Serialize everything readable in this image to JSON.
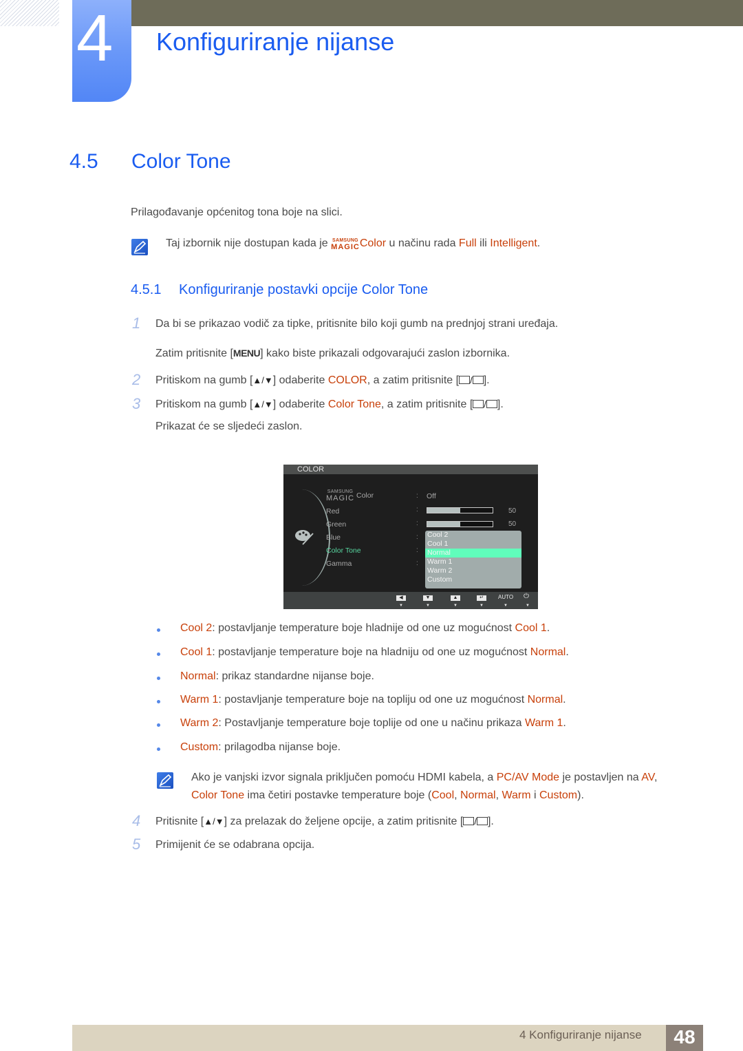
{
  "chapter": {
    "number": "4",
    "title": "Konfiguriranje nijanse"
  },
  "section": {
    "number": "4.5",
    "title": "Color Tone"
  },
  "intro": "Prilagođavanje općenitog tona boje na slici.",
  "note1": {
    "icon": "note-pencil-icon",
    "before": "Taj izbornik nije dostupan kada je ",
    "magic_small": "SAMSUNG",
    "magic_big": "MAGIC",
    "magic_word": "Color",
    "mid": " u načinu rada ",
    "opt1": "Full",
    "or": " ili ",
    "opt2": "Intelligent",
    "end": "."
  },
  "subsection": {
    "number": "4.5.1",
    "title": "Konfiguriranje postavki opcije Color Tone"
  },
  "steps": {
    "s1": {
      "num": "1",
      "text": "Da bi se prikazao vodič za tipke, pritisnite bilo koji gumb na prednjoj strani uređaja.",
      "text2a": "Zatim pritisnite [",
      "key": "MENU",
      "text2b": "] kako biste prikazali odgovarajući zaslon izbornika."
    },
    "s2": {
      "num": "2",
      "a": "Pritiskom na gumb [",
      "updown": "▲/▼",
      "b": "] odaberite ",
      "hl": "COLOR",
      "c": ", a zatim pritisnite [",
      "d": "]."
    },
    "s3": {
      "num": "3",
      "a": "Pritiskom na gumb [",
      "updown": "▲/▼",
      "b": "] odaberite ",
      "hl": "Color Tone",
      "c": ", a zatim pritisnite [",
      "d": "].",
      "after": "Prikazat će se sljedeći zaslon."
    },
    "s4": {
      "num": "4",
      "a": "Pritisnite [",
      "updown": "▲/▼",
      "b": "] za prelazak do željene opcije, a zatim pritisnite [",
      "d": "]."
    },
    "s5": {
      "num": "5",
      "text": "Primijenit će se odabrana opcija."
    }
  },
  "osd": {
    "header": "COLOR",
    "magic_small": "SAMSUNG",
    "magic_big": "MAGIC",
    "magic_label": "Color",
    "magic_value": "Off",
    "items": [
      "Red",
      "Green",
      "Blue",
      "Color Tone",
      "Gamma"
    ],
    "selected_item": "Color Tone",
    "red": {
      "value": "50",
      "fraction": 0.5
    },
    "green": {
      "value": "50",
      "fraction": 0.5
    },
    "dropdown": [
      "Cool 2",
      "Cool 1",
      "Normal",
      "Warm 1",
      "Warm 2",
      "Custom"
    ],
    "dropdown_selected": "Normal",
    "footer_buttons": [
      "left-arrow",
      "down-arrow",
      "up-arrow",
      "enter",
      "AUTO",
      "power"
    ],
    "auto_label": "AUTO",
    "accent_color": "#60fdbb"
  },
  "bullets": [
    {
      "term": "Cool 2",
      "text": ": postavljanje temperature boje hladnije od one uz mogućnost ",
      "ref": "Cool 1",
      "end": "."
    },
    {
      "term": "Cool 1",
      "text": ": postavljanje temperature boje na hladniju od one uz mogućnost ",
      "ref": "Normal",
      "end": "."
    },
    {
      "term": "Normal",
      "text": ": prikaz standardne nijanse boje.",
      "ref": "",
      "end": ""
    },
    {
      "term": "Warm 1",
      "text": ": postavljanje temperature boje na topliju od one uz mogućnost ",
      "ref": "Normal",
      "end": "."
    },
    {
      "term": "Warm 2",
      "text": ": Postavljanje temperature boje toplije od one u načinu prikaza ",
      "ref": "Warm 1",
      "end": "."
    },
    {
      "term": "Custom",
      "text": ": prilagodba nijanse boje.",
      "ref": "",
      "end": ""
    }
  ],
  "note2": {
    "l1a": "Ako je vanjski izvor signala priključen pomoću HDMI kabela, a ",
    "l1b": "PC/AV Mode",
    "l1c": " je postavljen na ",
    "l1d": "AV",
    "l1e": ",",
    "l2a": "Color Tone",
    "l2b": " ima četiri postavke temperature boje (",
    "o1": "Cool",
    "sep1": ", ",
    "o2": "Normal",
    "sep2": ", ",
    "o3": "Warm",
    "sep3": " i ",
    "o4": "Custom",
    "l2e": ")."
  },
  "footer": {
    "text": "4 Konfiguriranje nijanse",
    "page": "48"
  },
  "colors": {
    "heading_blue": "#1a5cf0",
    "highlight": "#c8400a",
    "top_bar": "#6e6c59",
    "footer_bar": "#dcd4c0",
    "page_box": "#8c8178"
  }
}
